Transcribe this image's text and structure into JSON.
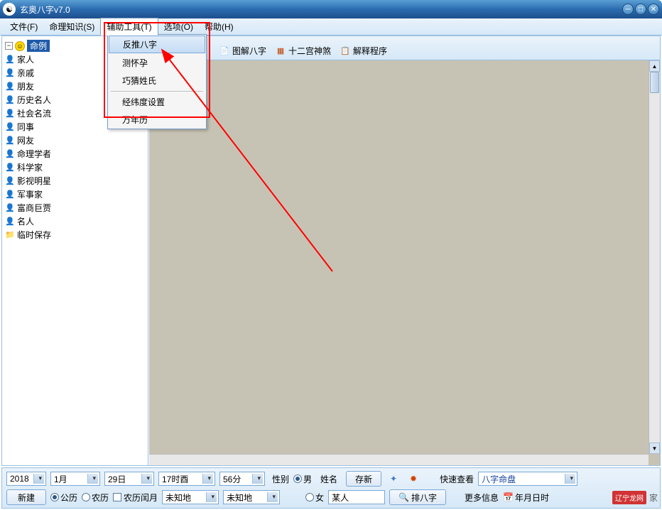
{
  "title": "玄奥八字v7.0",
  "menu": {
    "file": "文件(F)",
    "knowledge": "命理知识(S)",
    "tools": "辅助工具(T)",
    "options": "选项(O)",
    "help": "帮助(H)"
  },
  "dropdown": {
    "reverse": "反推八字",
    "pregnancy": "测怀孕",
    "guess_surname": "巧猜姓氏",
    "lonlat": "经纬度设置",
    "calendar": "万年历"
  },
  "toolbar": {
    "diagram": "图解八字",
    "palaces": "十二宫神煞",
    "explain": "解释程序"
  },
  "tree": {
    "root": "命例",
    "items": [
      "家人",
      "亲戚",
      "朋友",
      "历史名人",
      "社会名流",
      "同事",
      "网友",
      "命理学者",
      "科学家",
      "影视明星",
      "军事家",
      "富商巨贾",
      "名人",
      "临时保存"
    ]
  },
  "bottom": {
    "year": "2018",
    "month": "1月",
    "day": "29日",
    "hour": "17时酉",
    "minute": "56分",
    "new": "新建",
    "solar": "公历",
    "lunar": "农历",
    "leap": "农历闰月",
    "place1": "未知地",
    "place2": "未知地",
    "gender_label": "性别",
    "male": "男",
    "female": "女",
    "name_label": "姓名",
    "name_value": "某人",
    "save_new": "存新",
    "arrange": "排八字",
    "quick_label": "快速查看",
    "quick_value": "八字命盘",
    "more_label": "更多信息",
    "more_value": "年月日时"
  },
  "watermark": {
    "badge": "辽宁龙网",
    "sub": "家"
  }
}
